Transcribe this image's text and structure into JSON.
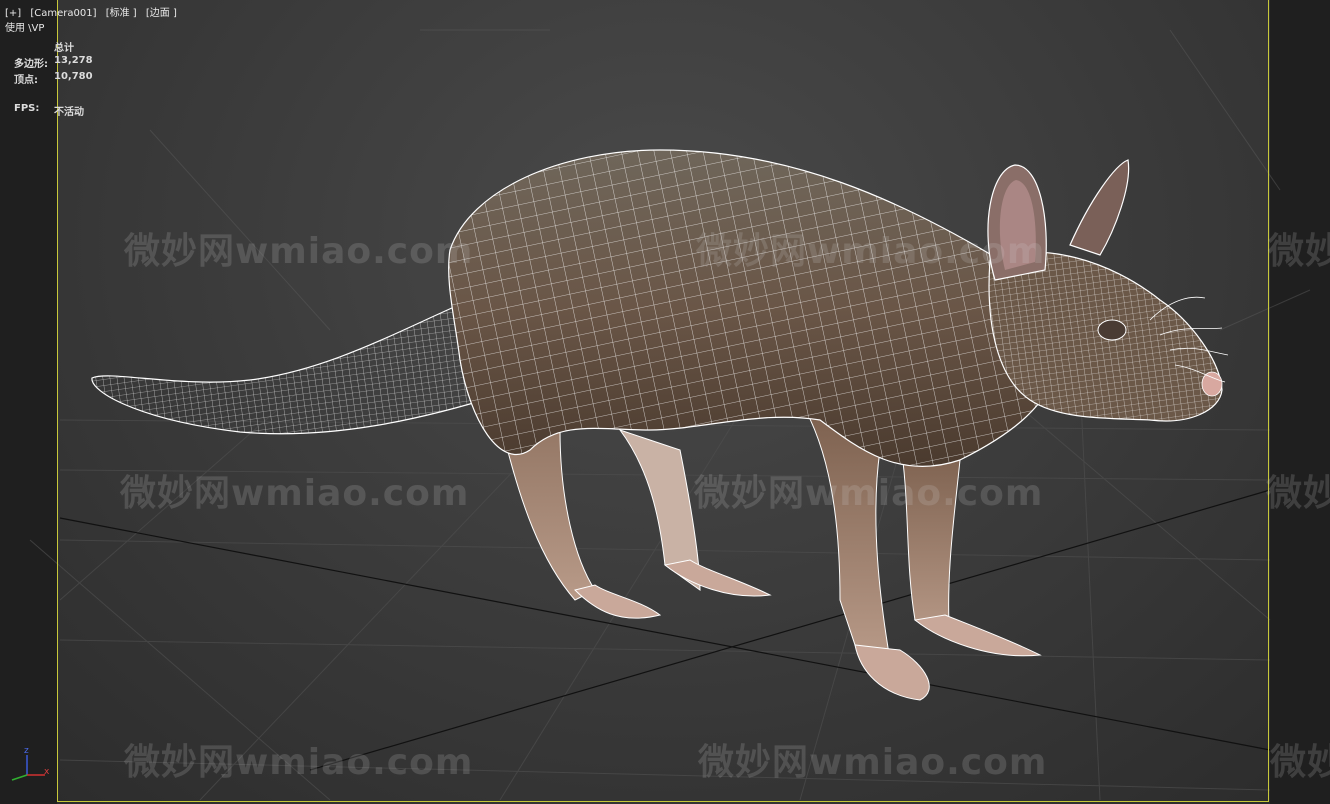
{
  "viewport": {
    "menu": [
      {
        "label": "[+]"
      },
      {
        "label": "[Camera001]"
      },
      {
        "label": "[标准 ]"
      },
      {
        "label": "[边面 ]"
      }
    ],
    "sub_label": "使用 \\VP",
    "stats": {
      "header": "总计",
      "polygons_label": "多边形:",
      "polygons_value": "13,278",
      "vertices_label": "顶点:",
      "vertices_value": "10,780",
      "fps_label": "FPS:",
      "fps_value": "不活动"
    },
    "gizmo": {
      "z": "z",
      "x": "x"
    }
  },
  "watermark": "微妙网wmiao.com",
  "colors": {
    "frame": "#c8c83a",
    "background": "#3c3c3c",
    "wire": "#ffffff",
    "fur": "#6d5e4e"
  }
}
